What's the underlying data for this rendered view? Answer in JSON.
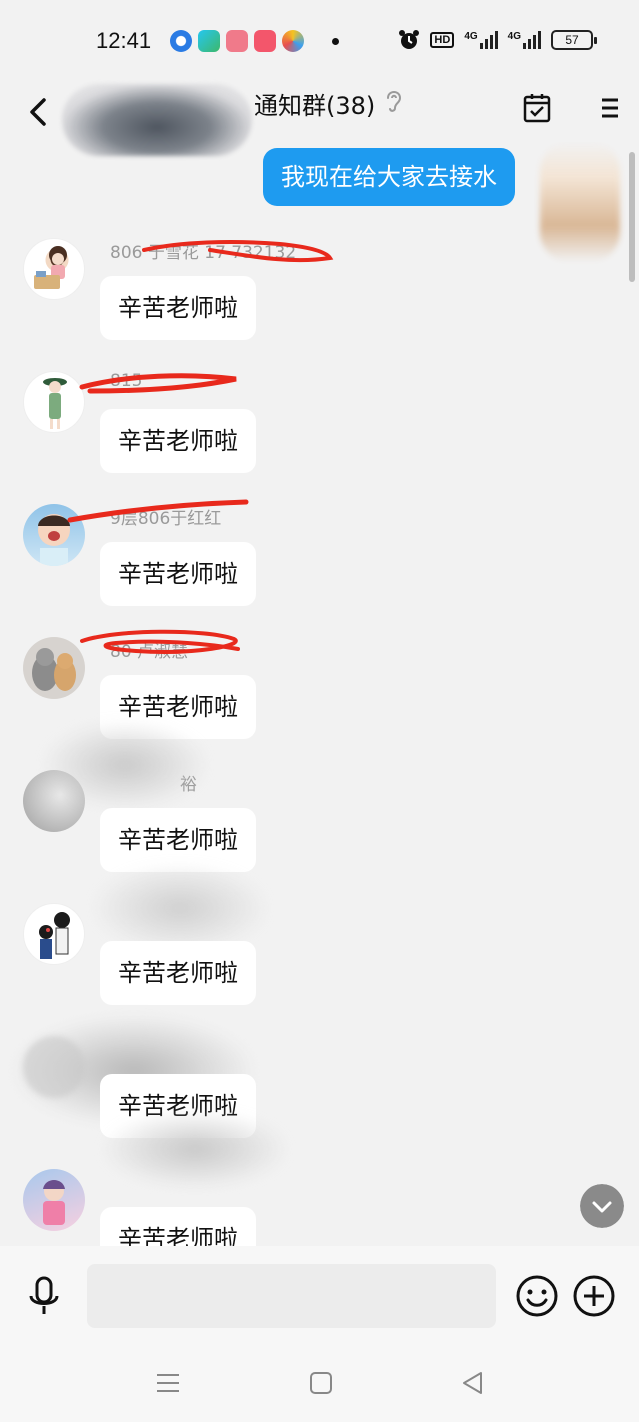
{
  "status_bar": {
    "time": "12:41",
    "battery": "57",
    "net1": "4G",
    "net2": "4G",
    "hd": "HD"
  },
  "header": {
    "title": "通知群(38)"
  },
  "my_message": {
    "text": "我现在给大家去接水"
  },
  "messages": [
    {
      "sender": "806 于雪花 17   732132",
      "text": "辛苦老师啦"
    },
    {
      "sender": "815",
      "text": "辛苦老师啦"
    },
    {
      "sender": "9层806于红红",
      "text": "辛苦老师啦"
    },
    {
      "sender": "80  卢淑慧",
      "text": "辛苦老师啦"
    },
    {
      "sender": "裕",
      "text": "辛苦老师啦"
    },
    {
      "sender": "",
      "text": "辛苦老师啦"
    },
    {
      "sender": "",
      "text": "辛苦老师啦"
    },
    {
      "sender": "",
      "text": "辛苦老师啦"
    }
  ],
  "colors": {
    "my_bubble": "#1e9bf0",
    "background": "#f2f2f2",
    "redaction": "#e8291c"
  },
  "icons": {
    "back": "back-arrow-icon",
    "ear": "ear-icon",
    "calendar": "calendar-check-icon",
    "menu": "more-menu-icon",
    "mic": "microphone-icon",
    "emoji": "emoji-icon",
    "add": "plus-circle-icon",
    "nav_menu": "nav-menu-icon",
    "nav_home": "nav-home-icon",
    "nav_back": "nav-back-icon",
    "scroll_down": "chevron-down-icon"
  }
}
